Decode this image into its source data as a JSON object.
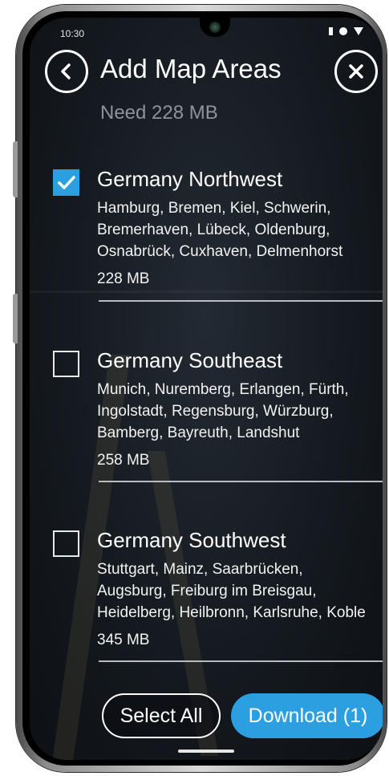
{
  "status_bar": {
    "time": "10:30"
  },
  "header": {
    "title": "Add Map Areas",
    "need": "Need 228 MB",
    "back_icon": "chevron-left-icon",
    "close_icon": "close-icon"
  },
  "areas": [
    {
      "name": "Germany Northwest",
      "checked": true,
      "cities": "Hamburg, Bremen, Kiel, Schwerin,\nBremerhaven, Lübeck, Oldenburg,\nOsnabrück, Cuxhaven, Delmenhorst",
      "size": "228 MB"
    },
    {
      "name": "Germany Southeast",
      "checked": false,
      "cities": "Munich, Nuremberg, Erlangen, Fürth,\nIngolstadt, Regensburg, Würzburg,\nBamberg, Bayreuth, Landshut",
      "size": "258 MB"
    },
    {
      "name": "Germany Southwest",
      "checked": false,
      "cities": "Stuttgart, Mainz, Saarbrücken,\nAugsburg, Freiburg im Breisgau,\nHeidelberg, Heilbronn, Karlsruhe, Koble",
      "size": "345 MB"
    }
  ],
  "footer": {
    "select_all": "Select All",
    "download": "Download (1)"
  },
  "colors": {
    "accent": "#2b9fe0",
    "background": "#151a20",
    "muted_text": "#8d939b"
  }
}
